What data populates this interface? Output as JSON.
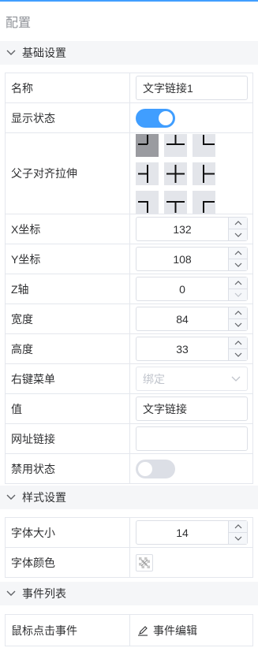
{
  "panel": {
    "title": "配置"
  },
  "sections": {
    "basic": {
      "title": "基础设置"
    },
    "style": {
      "title": "样式设置"
    },
    "events": {
      "title": "事件列表"
    }
  },
  "basic": {
    "name": {
      "label": "名称",
      "value": "文字链接1"
    },
    "visible": {
      "label": "显示状态",
      "on": true
    },
    "align": {
      "label": "父子对齐拉伸",
      "selected": "top-left"
    },
    "x": {
      "label": "X坐标",
      "value": "132"
    },
    "y": {
      "label": "Y坐标",
      "value": "108"
    },
    "z": {
      "label": "Z轴",
      "value": "0"
    },
    "width": {
      "label": "宽度",
      "value": "84"
    },
    "height": {
      "label": "高度",
      "value": "33"
    },
    "context_menu": {
      "label": "右键菜单",
      "placeholder": "绑定"
    },
    "value": {
      "label": "值",
      "value": "文字链接"
    },
    "url": {
      "label": "网址链接",
      "value": ""
    },
    "disabled": {
      "label": "禁用状态",
      "on": false
    }
  },
  "style": {
    "font_size": {
      "label": "字体大小",
      "value": "14"
    },
    "font_color": {
      "label": "字体颜色"
    }
  },
  "events": {
    "click": {
      "label": "鼠标点击事件",
      "action": "事件编辑"
    }
  },
  "colors": {
    "accent": "#409eff",
    "switch_off": "#dcdfe6",
    "align_active": "#9a9ba0"
  }
}
